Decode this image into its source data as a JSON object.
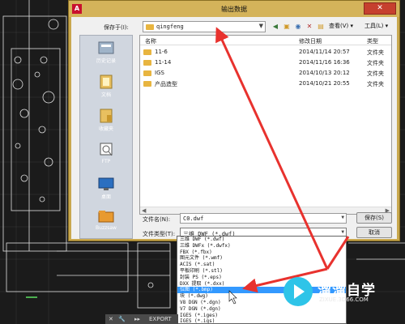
{
  "dialog": {
    "title": "输出数据",
    "close_glyph": "✕",
    "app_logo": "A"
  },
  "save_in": {
    "label": "保存于(I):",
    "value": "qingfeng"
  },
  "toolbar": {
    "views_label": "查看(V)",
    "tools_label": "工具(L)"
  },
  "places": [
    {
      "label": "历史记录",
      "icon": "history-icon"
    },
    {
      "label": "文档",
      "icon": "documents-icon"
    },
    {
      "label": "收藏夹",
      "icon": "favorites-icon"
    },
    {
      "label": "FTP",
      "icon": "ftp-icon"
    },
    {
      "label": "桌面",
      "icon": "desktop-icon"
    },
    {
      "label": "Buzzsaw",
      "icon": "buzzsaw-icon"
    }
  ],
  "file_list": {
    "columns": {
      "name": "名称",
      "modified": "修改日期",
      "type": "类型"
    },
    "rows": [
      {
        "name": "11-6",
        "modified": "2014/11/14 20:57",
        "type": "文件夹"
      },
      {
        "name": "11-14",
        "modified": "2014/11/16 16:36",
        "type": "文件夹"
      },
      {
        "name": "IGS",
        "modified": "2014/10/13 20:12",
        "type": "文件夹"
      },
      {
        "name": "产品造型",
        "modified": "2014/10/21 20:55",
        "type": "文件夹"
      }
    ]
  },
  "filename": {
    "label": "文件名(N):",
    "value": "C0.dwf"
  },
  "filetype": {
    "label": "文件类型(T):",
    "value": "三维 DWF (*.dwf)"
  },
  "buttons": {
    "save": "保存(S)",
    "cancel": "取消"
  },
  "filetype_options": [
    {
      "label": "三维 DWF (*.dwf)",
      "selected": false
    },
    {
      "label": "三维 DWFx (*.dwfx)",
      "selected": false
    },
    {
      "label": "FBX (*.fbx)",
      "selected": false
    },
    {
      "label": "图元文件 (*.wmf)",
      "selected": false
    },
    {
      "label": "ACIS (*.sat)",
      "selected": false
    },
    {
      "label": "平板印刷 (*.stl)",
      "selected": false
    },
    {
      "label": "封装 PS (*.eps)",
      "selected": false
    },
    {
      "label": "DXX 提取 (*.dxx)",
      "selected": false
    },
    {
      "label": "位图 (*.bmp)",
      "selected": true
    },
    {
      "label": "块 (*.dwg)",
      "selected": false
    },
    {
      "label": "V8 DGN (*.dgn)",
      "selected": false
    },
    {
      "label": "V7 DGN (*.dgn)",
      "selected": false
    },
    {
      "label": "IGES (*.iges)",
      "selected": false
    },
    {
      "label": "IGES (*.igs)",
      "selected": false
    }
  ],
  "watermark": {
    "title": "溜溜自学",
    "url": "ZIXUE.3D66.COM"
  },
  "command_bar": {
    "close": "✕",
    "wrench": "🔧",
    "chevron": "▸▸",
    "text": "EXPORT"
  },
  "colors": {
    "dialog_frame": "#c9a84e",
    "selection": "#3399ff",
    "annotation_arrow": "#e8322e"
  }
}
